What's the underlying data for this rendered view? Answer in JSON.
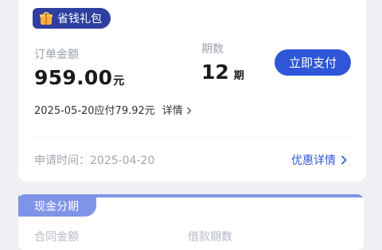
{
  "badge": {
    "label": "省钱礼包"
  },
  "order": {
    "amount_label": "订单金额",
    "amount": "959.00",
    "amount_unit": "元",
    "periods_label": "期数",
    "periods": "12",
    "periods_unit": "期",
    "pay_button": "立即支付",
    "due_text": "2025-05-20应付79.92元",
    "due_detail": "详情",
    "apply_time": "申请时间：2025-04-20",
    "promo_detail": "优惠详情"
  },
  "cash": {
    "tab": "现金分期",
    "contract_label": "合同金额",
    "loan_periods_label": "借款期数"
  },
  "colors": {
    "accent": "#2f56d8",
    "badge": "#2f3f9f",
    "tab": "#7f94e6"
  }
}
